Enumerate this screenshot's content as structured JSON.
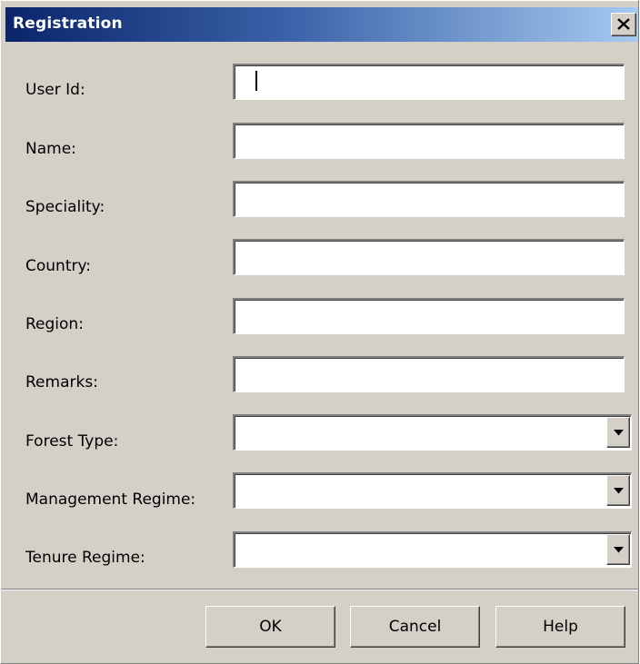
{
  "window": {
    "title": "Registration",
    "close_glyph": "close-icon"
  },
  "form": {
    "fields": [
      {
        "label": "User Id:",
        "value": ""
      },
      {
        "label": "Name:",
        "value": ""
      },
      {
        "label": "Speciality:",
        "value": ""
      },
      {
        "label": "Country:",
        "value": ""
      },
      {
        "label": "Region:",
        "value": ""
      },
      {
        "label": "Remarks:",
        "value": ""
      }
    ],
    "dropdowns": [
      {
        "label": "Forest Type:",
        "selected": ""
      },
      {
        "label": "Management Regime:",
        "selected": ""
      },
      {
        "label": "Tenure Regime:",
        "selected": ""
      }
    ]
  },
  "buttons": {
    "ok": "OK",
    "cancel": "Cancel",
    "help": "Help"
  },
  "colors": {
    "face": "#d4d0c8",
    "title_start": "#0a246a",
    "title_end": "#a6caf0"
  }
}
